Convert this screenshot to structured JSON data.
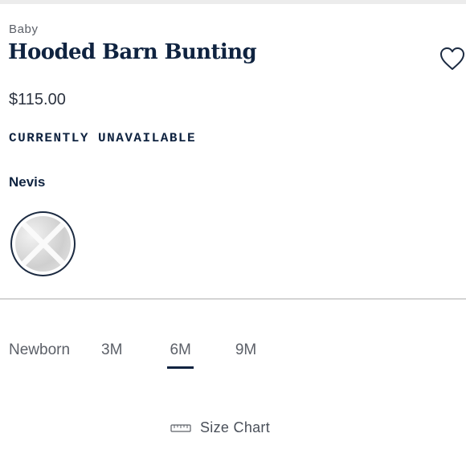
{
  "product": {
    "category": "Baby",
    "title": "Hooded Barn Bunting",
    "price": "$115.00",
    "availability": "CURRENTLY UNAVAILABLE",
    "favorite_icon": "heart-outline-icon"
  },
  "color": {
    "selected_name": "Nevis",
    "swatches": [
      {
        "name": "Nevis",
        "selected": true,
        "unavailable": true
      }
    ]
  },
  "sizes": {
    "options": [
      "Newborn",
      "3M",
      "6M",
      "9M"
    ],
    "selected": "6M"
  },
  "size_chart": {
    "label": "Size Chart",
    "icon": "ruler-icon"
  },
  "colors": {
    "navy": "#0f2340",
    "muted_text": "#5c6068",
    "divider": "#d4d4d4"
  }
}
